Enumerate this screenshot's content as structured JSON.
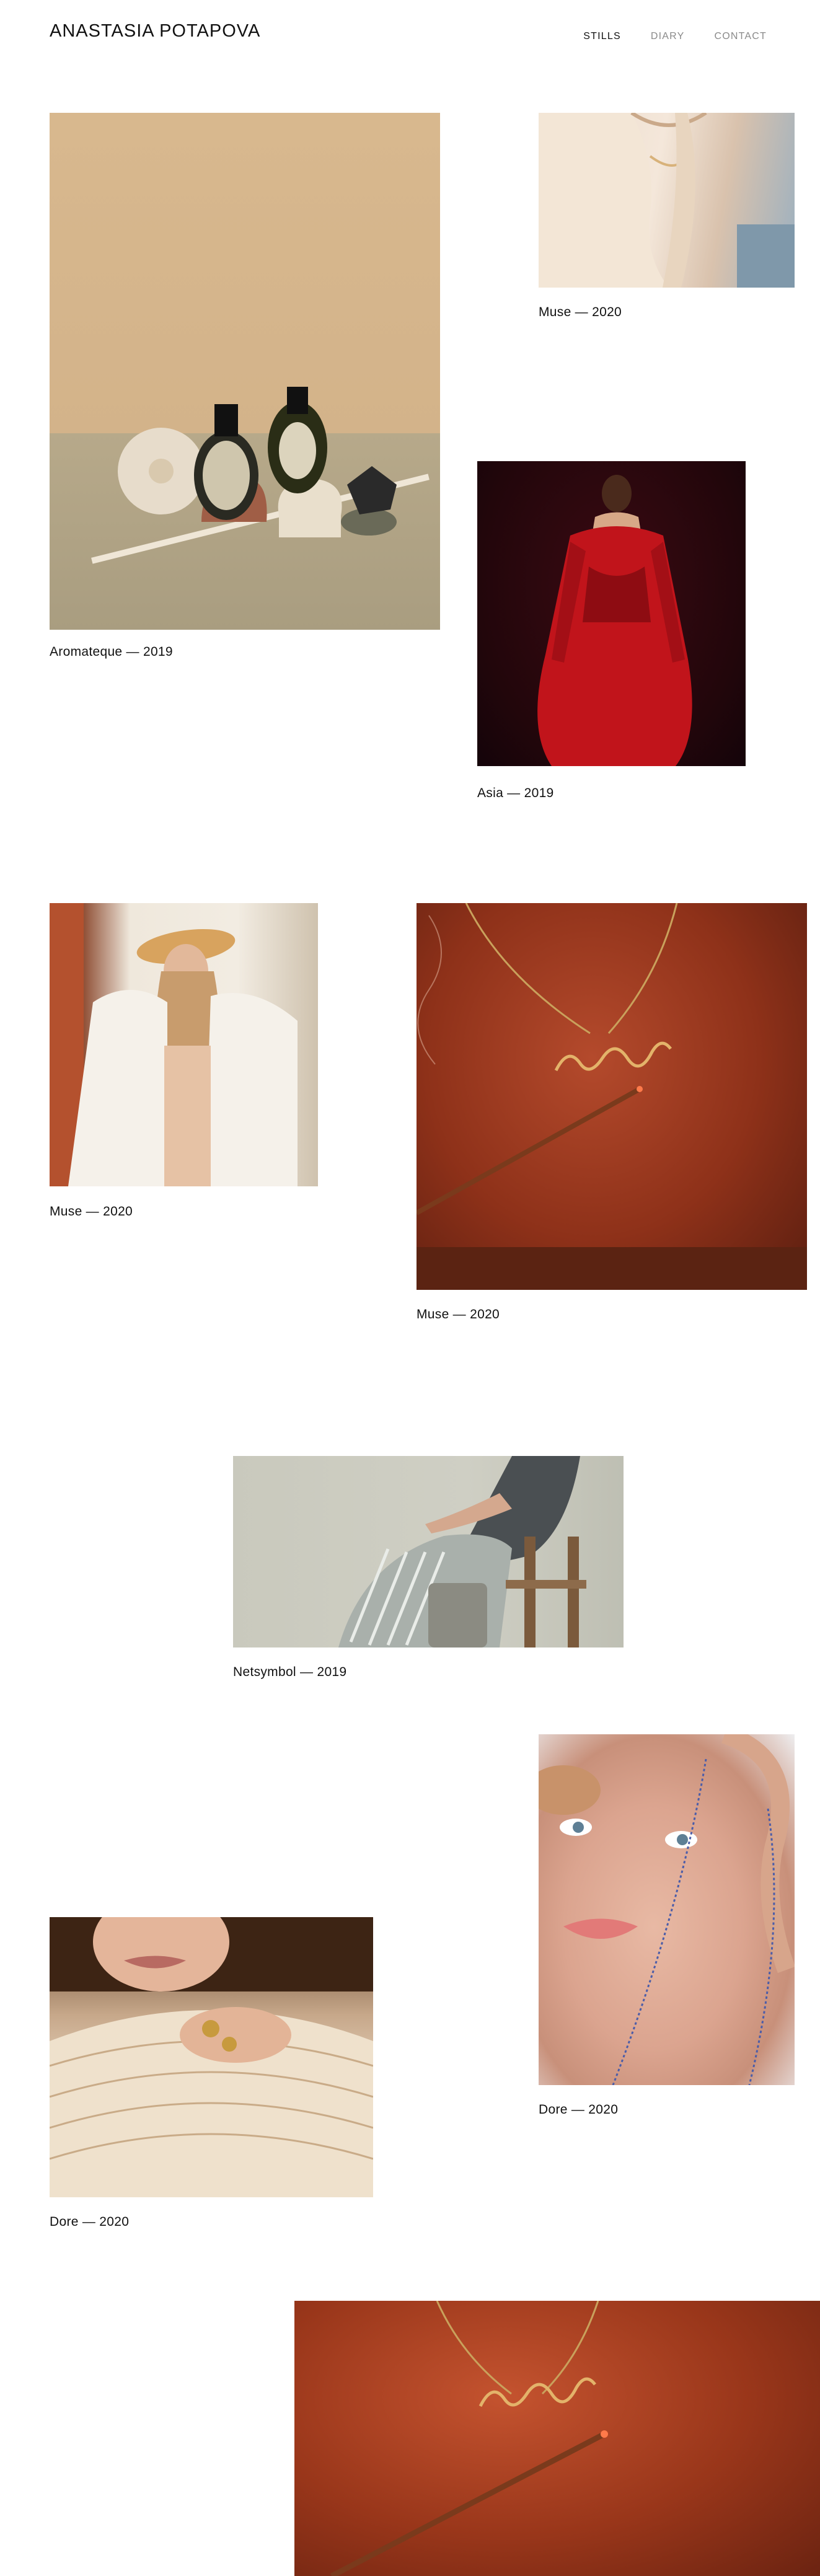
{
  "site": {
    "title": "ANASTASIA POTAPOVA"
  },
  "nav": {
    "items": [
      {
        "label": "STILLS",
        "active": true
      },
      {
        "label": "DIARY",
        "active": false
      },
      {
        "label": "CONTACT",
        "active": false
      }
    ]
  },
  "gallery": {
    "items": [
      {
        "caption": "Aromateque — 2019"
      },
      {
        "caption": "Muse — 2020"
      },
      {
        "caption": "Asia — 2019"
      },
      {
        "caption": "Muse — 2020"
      },
      {
        "caption": "Muse — 2020"
      },
      {
        "caption": "Netsymbol — 2019"
      },
      {
        "caption": "Dore — 2020"
      },
      {
        "caption": "Dore — 2020"
      }
    ]
  },
  "colors": {
    "text": "#111111",
    "nav_inactive": "#8a8a8a",
    "background": "#ffffff"
  }
}
